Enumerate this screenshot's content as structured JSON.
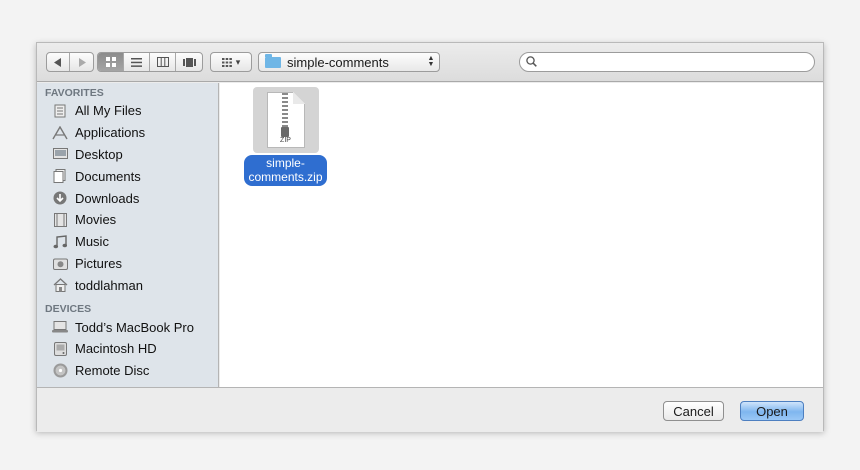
{
  "toolbar": {
    "back_icon": "back-arrow-icon",
    "forward_icon": "forward-arrow-icon",
    "views": [
      {
        "name": "icon-view",
        "glyph": "▦",
        "active": true
      },
      {
        "name": "list-view",
        "glyph": "≡",
        "active": false
      },
      {
        "name": "column-view",
        "glyph": "▥",
        "active": false
      },
      {
        "name": "coverflow-view",
        "glyph": "▤",
        "active": false
      }
    ],
    "arrange_glyph": "▦",
    "arrange_arrow": "▾",
    "location": "simple-comments",
    "search_value": ""
  },
  "sidebar": {
    "favorites_heading": "FAVORITES",
    "favorites": [
      {
        "label": "All My Files",
        "icon": "all-files-icon",
        "glyph": "☰"
      },
      {
        "label": "Applications",
        "icon": "applications-icon",
        "glyph": "A"
      },
      {
        "label": "Desktop",
        "icon": "desktop-icon",
        "glyph": "▭"
      },
      {
        "label": "Documents",
        "icon": "documents-icon",
        "glyph": "▤"
      },
      {
        "label": "Downloads",
        "icon": "downloads-icon",
        "glyph": "⬇"
      },
      {
        "label": "Movies",
        "icon": "movies-icon",
        "glyph": "▦"
      },
      {
        "label": "Music",
        "icon": "music-icon",
        "glyph": "♫"
      },
      {
        "label": "Pictures",
        "icon": "pictures-icon",
        "glyph": "◙"
      },
      {
        "label": "toddlahman",
        "icon": "home-icon",
        "glyph": "⌂"
      }
    ],
    "devices_heading": "DEVICES",
    "devices": [
      {
        "label": "Todd’s MacBook Pro",
        "icon": "laptop-icon",
        "glyph": "▭"
      },
      {
        "label": "Macintosh HD",
        "icon": "hard-disk-icon",
        "glyph": "▣"
      },
      {
        "label": "Remote Disc",
        "icon": "disc-icon",
        "glyph": "◎"
      }
    ]
  },
  "files": [
    {
      "label": "simple-comments.zip",
      "label_line1": "simple-",
      "label_line2": "comments.zip",
      "type_text": "ZIP",
      "selected": true
    }
  ],
  "footer": {
    "cancel_label": "Cancel",
    "open_label": "Open"
  },
  "colors": {
    "selection": "#2f6ed0",
    "sidebar_bg": "#dee4ea",
    "default_button": "#7fb6ef"
  }
}
